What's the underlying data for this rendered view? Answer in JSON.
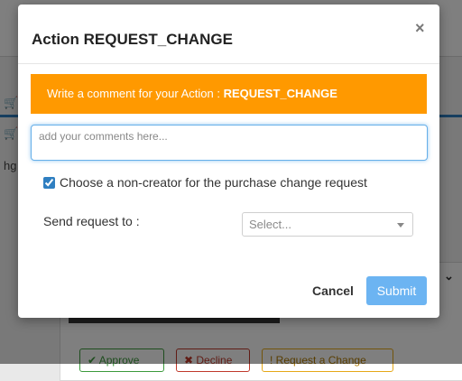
{
  "background": {
    "cart_icons": [
      "shopping-cart-icon",
      "shopping-cart-icon"
    ],
    "partial_text": "hg",
    "buttons": {
      "approve_label": "✔ Approve",
      "decline_label": "✖ Decline",
      "request_change_label": "! Request a Change"
    }
  },
  "modal": {
    "title": "Action REQUEST_CHANGE",
    "close_label": "×",
    "alert": {
      "prefix": "Write a comment for your Action : ",
      "action": "REQUEST_CHANGE"
    },
    "comment": {
      "placeholder": "add your comments here...",
      "value": ""
    },
    "checkbox": {
      "label": "Choose a non-creator for the purchase change request",
      "checked": true
    },
    "send_to": {
      "label": "Send request to :",
      "placeholder": "Select..."
    },
    "footer": {
      "cancel_label": "Cancel",
      "submit_label": "Submit"
    }
  },
  "colors": {
    "alert_bg": "#ff9900",
    "submit_bg": "#6cb4f2",
    "focus_border": "#66afe9"
  }
}
